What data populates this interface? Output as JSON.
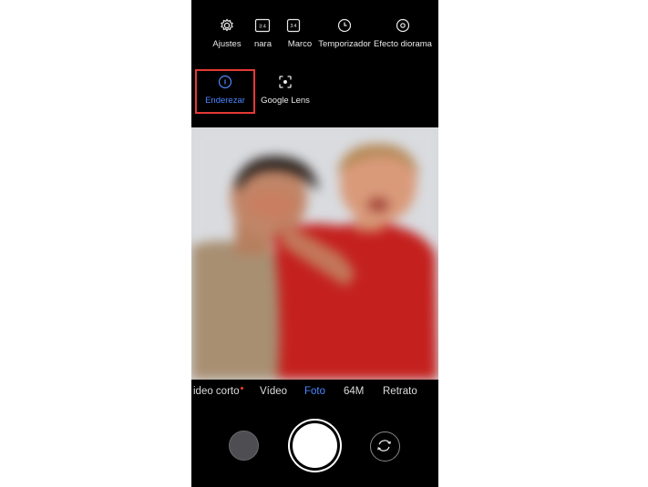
{
  "top_menu": [
    {
      "label": "Ajustes",
      "icon": "gear-icon"
    },
    {
      "label": "nara",
      "icon": "aspect-ratio-icon",
      "icon_text": "3:4"
    },
    {
      "label": "Marco",
      "icon": "frame-icon"
    },
    {
      "label": "Temporizador",
      "icon": "timer-icon"
    },
    {
      "label": "Efecto diorama",
      "icon": "diorama-icon"
    }
  ],
  "second_menu": [
    {
      "label": "Enderezar",
      "icon": "straighten-icon",
      "active": true
    },
    {
      "label": "Google Lens",
      "icon": "google-lens-icon",
      "active": false
    }
  ],
  "modes": [
    {
      "label": "ideo corto",
      "new_dot": true
    },
    {
      "label": "Vídeo"
    },
    {
      "label": "Foto",
      "active": true
    },
    {
      "label": "64M"
    },
    {
      "label": "Retrato"
    }
  ],
  "colors": {
    "accent": "#4d86ff",
    "highlight": "#e53935",
    "background": "#000000"
  }
}
